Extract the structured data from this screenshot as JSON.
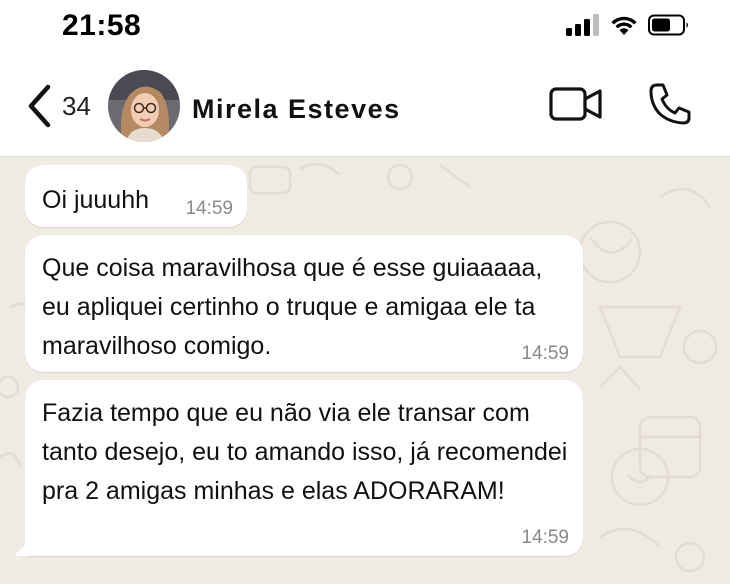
{
  "status_bar": {
    "time": "21:58",
    "icons": [
      "signal-icon",
      "wifi-icon",
      "battery-icon"
    ]
  },
  "header": {
    "back_count": "34",
    "contact_name": "Mirela Esteves",
    "icons": [
      "back-chevron-icon",
      "video-camera-icon",
      "phone-icon"
    ]
  },
  "colors": {
    "chat_background": "#efeae2",
    "bubble_incoming": "#ffffff",
    "timestamp": "#8a8a8a"
  },
  "messages": [
    {
      "text": "Oi juuuhh",
      "time": "14:59"
    },
    {
      "text": "Que coisa maravilhosa que é esse guiaaaaa, eu apliquei certinho o truque e amigaa ele ta maravilhoso comigo.",
      "time": "14:59"
    },
    {
      "text": "Fazia tempo que eu não via ele transar com tanto desejo, eu to amando isso, já recomendei pra 2 amigas minhas e elas ADORARAM!",
      "time": "14:59"
    }
  ]
}
